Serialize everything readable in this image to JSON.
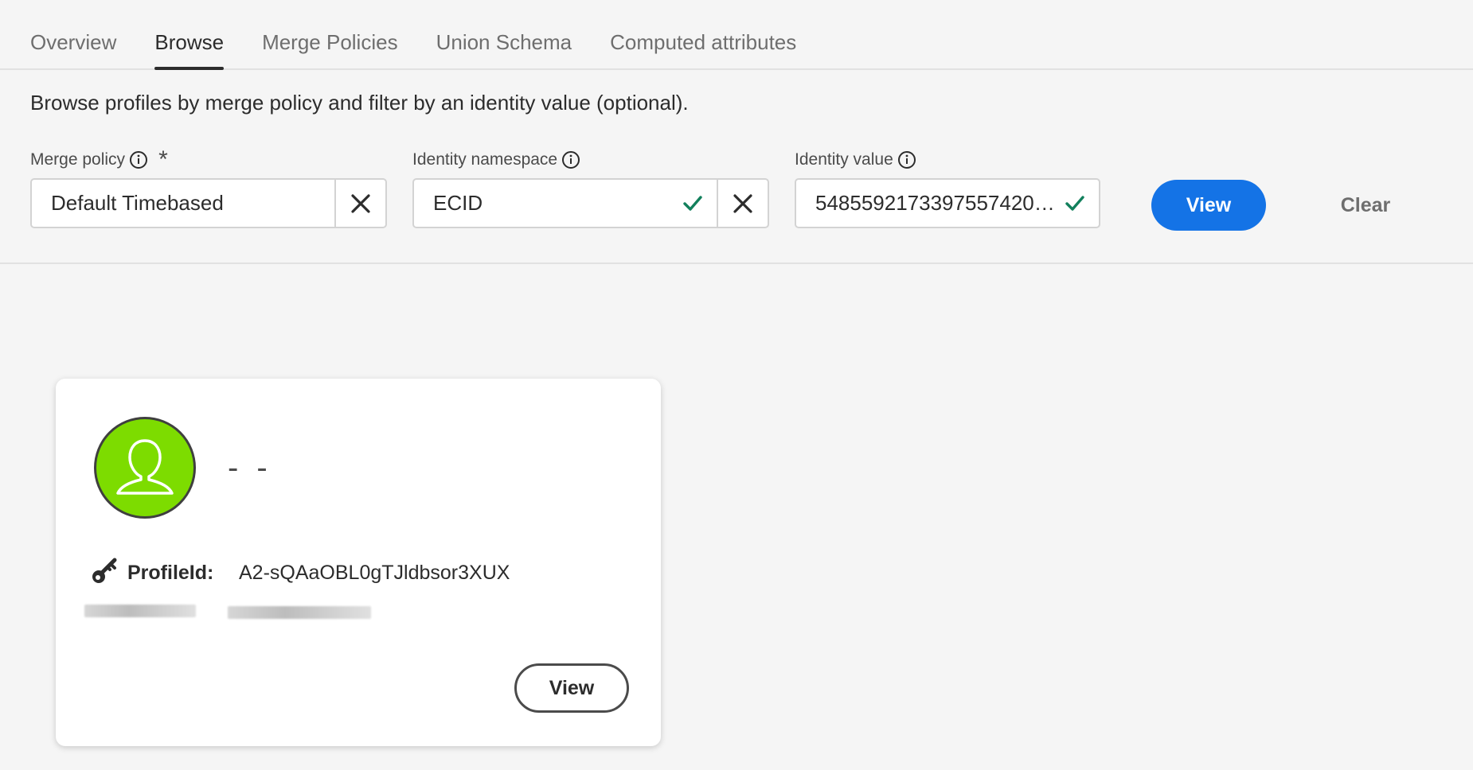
{
  "tabs": [
    {
      "label": "Overview",
      "active": false
    },
    {
      "label": "Browse",
      "active": true
    },
    {
      "label": "Merge Policies",
      "active": false
    },
    {
      "label": "Union Schema",
      "active": false
    },
    {
      "label": "Computed attributes",
      "active": false
    }
  ],
  "description": "Browse profiles by merge policy and filter by an identity value (optional).",
  "fields": {
    "merge_policy": {
      "label": "Merge policy",
      "required_mark": "*",
      "value": "Default Timebased"
    },
    "identity_namespace": {
      "label": "Identity namespace",
      "value": "ECID"
    },
    "identity_value": {
      "label": "Identity value",
      "value": "5485592173397557420…"
    }
  },
  "actions": {
    "view_label": "View",
    "clear_label": "Clear"
  },
  "profile_card": {
    "name": "- -",
    "profile_id_label": "ProfileId:",
    "profile_id_value": "A2-sQAaOBL0gTJldbsor3XUX",
    "view_label": "View"
  },
  "colors": {
    "accent": "#1473e6",
    "avatar_bg": "#7ddc00",
    "valid_check": "#12805c"
  },
  "icons": {
    "info": "info-icon",
    "clear": "close-icon",
    "valid": "checkmark-icon",
    "avatar": "user-icon",
    "key": "key-icon"
  }
}
